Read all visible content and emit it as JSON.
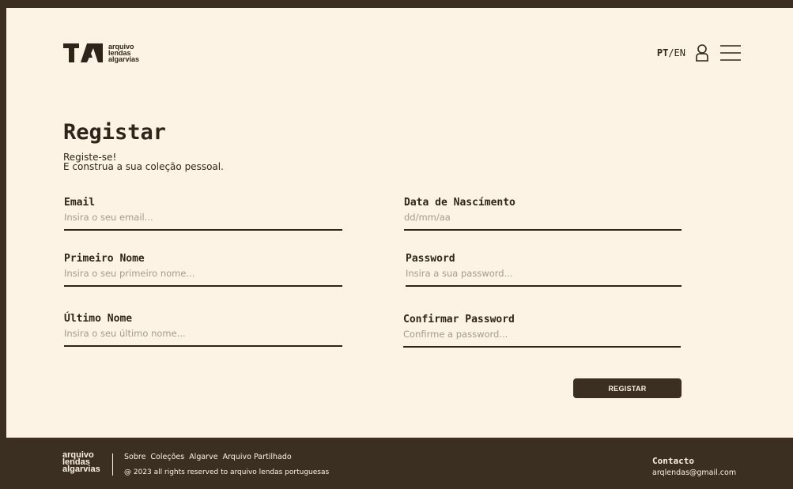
{
  "header": {
    "logo_lines": [
      "arquivo",
      "lendas",
      "algarvias"
    ],
    "lang_active": "PT",
    "lang_separator": "/",
    "lang_other": "EN"
  },
  "page": {
    "title": "Registar",
    "subtitle_line1": "Registe-se!",
    "subtitle_line2": "E construa a sua coleção pessoal."
  },
  "form": {
    "email": {
      "label": "Email",
      "placeholder": "Insira o seu email..."
    },
    "birthdate": {
      "label": "Data de Nascímento",
      "placeholder": "dd/mm/aa"
    },
    "first_name": {
      "label": "Primeiro Nome",
      "placeholder": "Insira o seu primeiro nome..."
    },
    "password": {
      "label": "Password",
      "placeholder": "Insira a sua password..."
    },
    "last_name": {
      "label": "Último Nome",
      "placeholder": "Insira o seu último nome..."
    },
    "confirm_password": {
      "label": "Confirmar Password",
      "placeholder": "Confirme a password..."
    },
    "submit_label": "REGISTAR"
  },
  "footer": {
    "logo_lines": [
      "arquivo",
      "lendas",
      "algarvias"
    ],
    "links": [
      "Sobre",
      "Coleções",
      "Algarve",
      "Arquivo Partilhado"
    ],
    "copyright": "@ 2023 all rights reserved to arquivo lendas portuguesas",
    "contact_title": "Contacto",
    "contact_email": "arqlendas@gmail.com"
  },
  "colors": {
    "background": "#fcf3e4",
    "dark": "#3a2f20",
    "text": "#2e2518",
    "placeholder": "#a59a8b"
  },
  "icons": [
    "logo-mark-icon",
    "user-icon",
    "menu-icon"
  ]
}
